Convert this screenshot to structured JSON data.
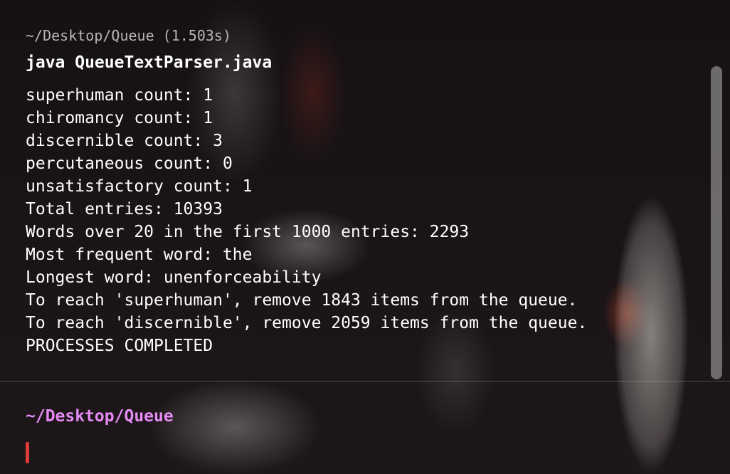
{
  "block": {
    "header": "~/Desktop/Queue (1.503s)",
    "command": "java QueueTextParser.java",
    "output_lines": [
      "superhuman count: 1",
      "chiromancy count: 1",
      "discernible count: 3",
      "percutaneous count: 0",
      "unsatisfactory count: 1",
      "Total entries: 10393",
      "Words over 20 in the first 1000 entries: 2293",
      "Most frequent word: the",
      "Longest word: unenforceability",
      "To reach 'superhuman', remove 1843 items from the queue.",
      "To reach 'discernible', remove 2059 items from the queue.",
      "PROCESSES COMPLETED"
    ]
  },
  "prompt": {
    "path": "~/Desktop/Queue"
  },
  "colors": {
    "prompt_path": "#e58bf5",
    "cursor": "#e03a3a",
    "command": "#ffffff",
    "header": "#b9b4b6"
  }
}
